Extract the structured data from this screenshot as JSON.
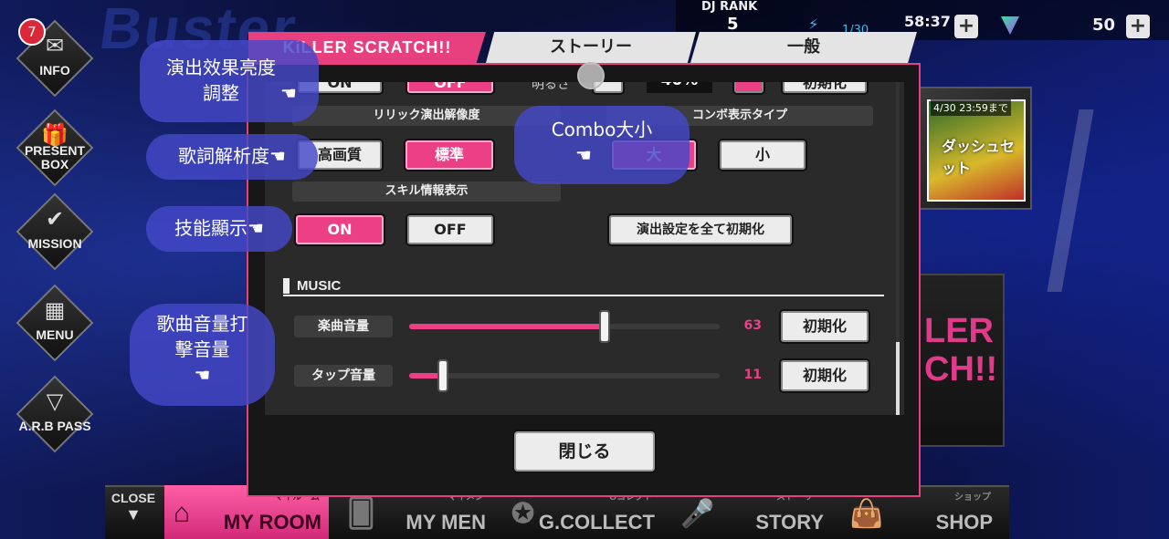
{
  "background": {
    "title_art": "Buster",
    "banner_time": "4/30 23:59まで",
    "banner_text": "ダッシュセット",
    "right_art": "LER CH!!"
  },
  "status_bar": {
    "dj_rank_label": "DJ RANK",
    "dj_rank_value": "5",
    "stamina_value": "1/30",
    "timer": "58:37",
    "gem_count": "50",
    "plus_glyph": "+"
  },
  "left_nav": [
    {
      "label": "INFO",
      "badge": "7",
      "icon": "envelope-icon"
    },
    {
      "label": "PRESENT BOX",
      "icon": "gift-icon"
    },
    {
      "label": "MISSION",
      "icon": "checkmark-icon"
    },
    {
      "label": "MENU",
      "icon": "grid-icon"
    },
    {
      "label": "A.R.B PASS",
      "icon": "pass-icon"
    }
  ],
  "bottom_nav": {
    "close_label": "CLOSE",
    "close_arrow": "▼",
    "items": [
      {
        "sub": "マイルーム",
        "label": "MY ROOM",
        "active": true
      },
      {
        "sub": "マイメン",
        "label": "MY MEN"
      },
      {
        "sub": "Gコレクト",
        "label": "G.COLLECT"
      },
      {
        "sub": "ストーリー",
        "label": "STORY"
      },
      {
        "sub": "ショップ",
        "label": "SHOP"
      }
    ]
  },
  "modal": {
    "tabs": [
      {
        "label": "KiLLER SCRATCH!!",
        "active": true
      },
      {
        "label": "ストーリー",
        "active": false
      },
      {
        "label": "一般",
        "active": false
      }
    ],
    "partial_row": {
      "on_label": "ON",
      "off_label": "OFF",
      "brightness_label": "明るさ",
      "brightness_value": "40%",
      "reset_label": "初期化"
    },
    "lyric_resolution": {
      "label": "リリック演出解像度",
      "options": [
        "高画質",
        "標準"
      ],
      "selected": "標準"
    },
    "combo_type": {
      "label": "コンボ表示タイプ",
      "options": [
        "大",
        "小"
      ],
      "selected": "大"
    },
    "skill_display": {
      "label": "スキル情報表示",
      "options": [
        "ON",
        "OFF"
      ],
      "selected": "ON"
    },
    "reset_all_label": "演出設定を全て初期化",
    "music_header": "MUSIC",
    "music_volume": {
      "label": "楽曲音量",
      "value": 63,
      "reset": "初期化"
    },
    "tap_volume": {
      "label": "タップ音量",
      "value": 11,
      "reset": "初期化"
    },
    "close_label": "閉じる"
  },
  "annotations": [
    {
      "text": "演出效果亮度調整",
      "hand": "☚"
    },
    {
      "text": "歌詞解析度",
      "hand": "☚"
    },
    {
      "text": "Combo大小",
      "hand": "☚"
    },
    {
      "text": "技能顯示",
      "hand": "☚"
    },
    {
      "text": "歌曲音量打擊音量",
      "hand": "☚"
    }
  ]
}
